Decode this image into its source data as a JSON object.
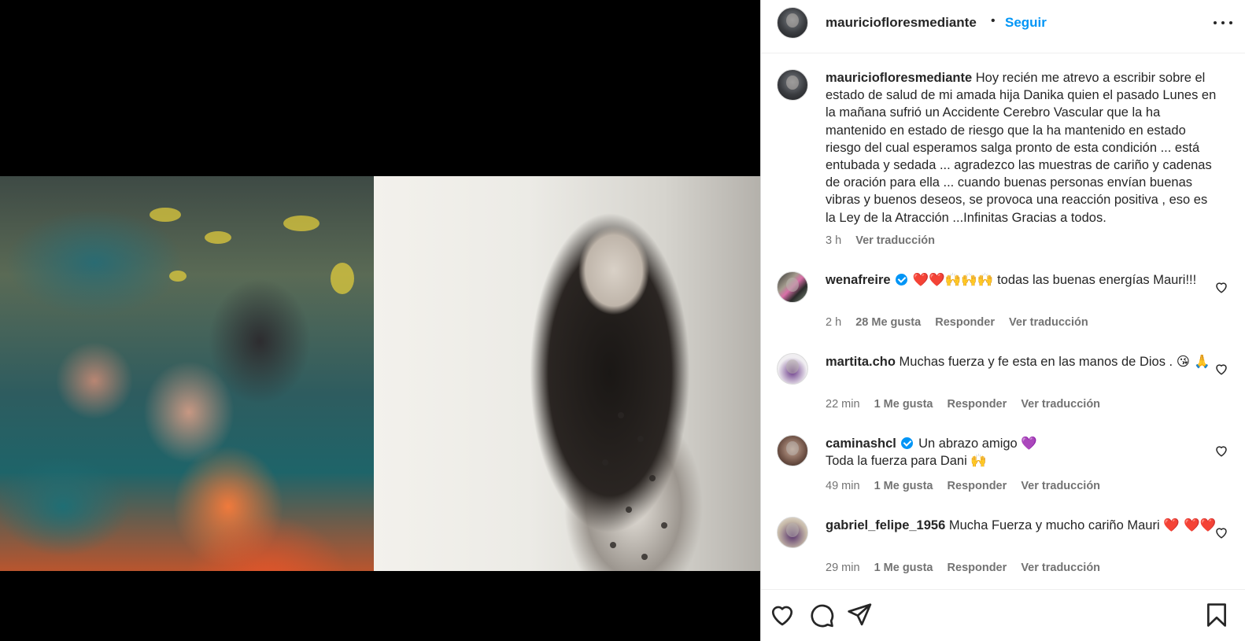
{
  "header": {
    "username": "mauriciofloresmediante",
    "separator": "•",
    "follow_label": "Seguir"
  },
  "caption": {
    "username": "mauriciofloresmediante",
    "text": "Hoy recién me atrevo a escribir sobre el estado de salud de mi amada hija Danika quien el pasado Lunes en la mañana sufrió un Accidente Cerebro Vascular que la ha mantenido en estado de riesgo que la ha mantenido en estado riesgo del cual esperamos salga pronto de esta condición ... está entubada y sedada ... agradezco las muestras de cariño y cadenas de oración para ella ... cuando buenas personas envían buenas vibras y buenos deseos, se provoca una reacción positiva , eso es la Ley de la Atracción ...Infinitas Gracias a todos.",
    "time": "3 h",
    "translate": "Ver traducción"
  },
  "comments": [
    {
      "username": "wenafreire",
      "emojis": "❤️❤️🙌🙌🙌",
      "text": "todas las buenas energías Mauri!!!",
      "time": "2 h",
      "likes": "28 Me gusta",
      "reply": "Responder",
      "translate": "Ver traducción"
    },
    {
      "username": "martita.cho",
      "text": "Muchas fuerza y fe esta en las manos de Dios .",
      "emojis": "😘 🙏",
      "time": "22 min",
      "likes": "1 Me gusta",
      "reply": "Responder",
      "translate": "Ver traducción"
    },
    {
      "username": "caminashcl",
      "text": "Un abrazo amigo",
      "emojis": "💜",
      "text2": "Toda la fuerza para Dani",
      "emojis2": "🙌",
      "time": "49 min",
      "likes": "1 Me gusta",
      "reply": "Responder",
      "translate": "Ver traducción"
    },
    {
      "username": "gabriel_felipe_1956",
      "text": "Mucha Fuerza y mucho cariño Mauri",
      "emojis": "❤️ ❤️❤️",
      "time": "29 min",
      "likes": "1 Me gusta",
      "reply": "Responder",
      "translate": "Ver traducción"
    }
  ],
  "icons": {
    "more": "more-options-icon",
    "like": "heart-icon",
    "comment": "comment-icon",
    "share": "share-icon",
    "save": "bookmark-icon"
  },
  "colors": {
    "link_blue": "#0095f6",
    "verified_blue": "#0095f6",
    "text_primary": "#262626",
    "text_secondary": "#737373"
  }
}
